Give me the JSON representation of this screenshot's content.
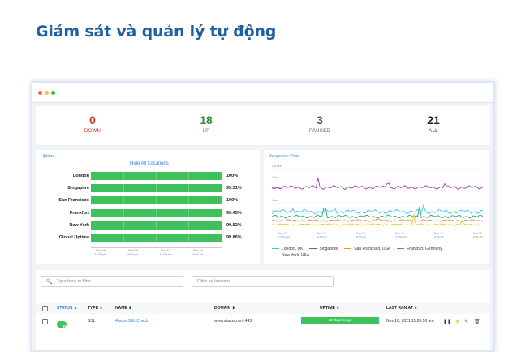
{
  "headline": "Giám sát và quản lý tự động",
  "window": {
    "dots": [
      "#ff5f57",
      "#febc2e",
      "#28c840"
    ]
  },
  "stats": [
    {
      "value": "0",
      "label": "DOWN",
      "color": "#c0392b"
    },
    {
      "value": "18",
      "label": "UP",
      "color": "#2e8b3a"
    },
    {
      "value": "3",
      "label": "PAUSED",
      "color": "#555555"
    },
    {
      "value": "21",
      "label": "ALL",
      "color": "#222222"
    }
  ],
  "uptime_panel": {
    "title": "Uptime",
    "hide_all": "Hide All Locations",
    "rows": [
      {
        "label": "London",
        "pct": "100%",
        "fill": 1.0
      },
      {
        "label": "Singapore",
        "pct": "99.31%",
        "fill": 0.9931
      },
      {
        "label": "San Francisco",
        "pct": "100%",
        "fill": 1.0
      },
      {
        "label": "Frankfurt",
        "pct": "99.45%",
        "fill": 0.9945
      },
      {
        "label": "New York",
        "pct": "99.52%",
        "fill": 0.9952
      },
      {
        "label": "Global Uptime",
        "pct": "99.86%",
        "fill": 0.9986
      }
    ],
    "x_ticks": [
      "Nov 15\n12:00 pm",
      "Nov 15\n6:00 pm",
      "Nov 16\n12:00 am",
      "Nov 16\n6:00 am"
    ]
  },
  "response_panel": {
    "title": "Response Time",
    "y_ticks": [
      "2.5 sec",
      "2 sec",
      "1.5 sec",
      "1 sec",
      "500 ms"
    ],
    "x_ticks": [
      "Nov 15\n12:00 pm",
      "Nov 15\n4:00 pm",
      "Nov 15\n8:00 pm",
      "Nov 16\n12:00 am",
      "Nov 16\n4:00 am",
      "Nov 16\n8:00 am"
    ],
    "legend": [
      {
        "name": "London, UK",
        "color": "#3ec6e0"
      },
      {
        "name": "Singapore",
        "color": "#9b3db5"
      },
      {
        "name": "San Francisco, USA",
        "color": "#f0902c"
      },
      {
        "name": "Frankfurt, Germany",
        "color": "#21a88a"
      },
      {
        "name": "New York, USA",
        "color": "#f2c21b"
      }
    ]
  },
  "filters": {
    "search_placeholder": "Type here to filter",
    "location_placeholder": "Filter by location"
  },
  "table": {
    "headers": {
      "status": "STATUS ▲",
      "type": "TYPE ⬍",
      "name": "NAME ⬍",
      "domain": "DOMAIN ⬍",
      "uptime": "UPTIME ⬍",
      "last_ran": "LAST RAN AT ⬍"
    },
    "rows": [
      {
        "status": "PASS",
        "type": "SSL",
        "name": "Atatus SSL Check",
        "domain": "www.atatus.com:443",
        "uptime": "23 days to go",
        "last_ran": "Nov 16, 2021 11:20:50 am"
      }
    ]
  }
}
